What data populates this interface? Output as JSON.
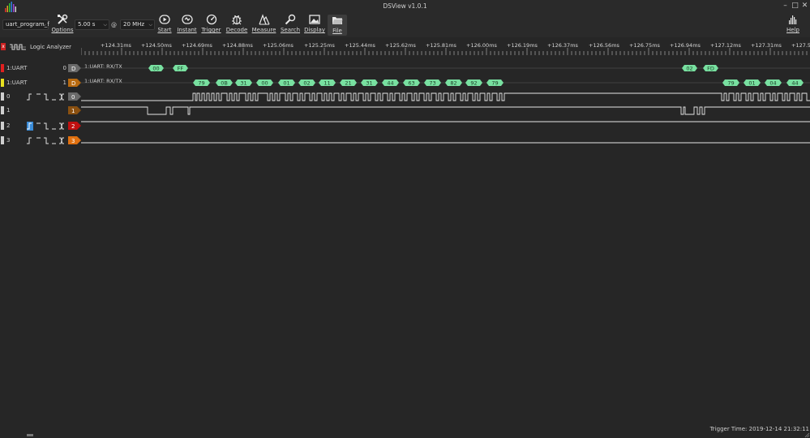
{
  "window": {
    "title": "DSView v1.0.1",
    "controls": {
      "minimize": "–",
      "maximize": "□",
      "close": "✕"
    }
  },
  "toolbar": {
    "device": "uart_program_f",
    "time_value": "5.00 s",
    "at": "@",
    "rate_value": "20 MHz",
    "buttons": {
      "options": "Options",
      "start": "Start",
      "instant": "Instant",
      "trigger": "Trigger",
      "decode": "Decode",
      "measure": "Measure",
      "search": "Search",
      "display": "Display",
      "file": "File",
      "help": "Help"
    }
  },
  "panel": {
    "close": "x",
    "title": "Logic Analyzer"
  },
  "ruler": {
    "labels": [
      "+124.31ms",
      "+124.50ms",
      "+124.69ms",
      "+124.88ms",
      "+125.06ms",
      "+125.25ms",
      "+125.44ms",
      "+125.62ms",
      "+125.81ms",
      "+126.00ms",
      "+126.19ms",
      "+126.37ms",
      "+126.56ms",
      "+126.75ms",
      "+126.94ms",
      "+127.12ms",
      "+127.31ms",
      "+127.50"
    ]
  },
  "channels": {
    "decoders": [
      {
        "label": "1:UART",
        "num": "0",
        "tag": "D",
        "name": "1:UART: RX/TX",
        "color": "#e02020",
        "tag_color": "#6a6a6a"
      },
      {
        "label": "1:UART",
        "num": "1",
        "tag": "D",
        "name": "1:UART: RX/TX",
        "color": "#e8e020",
        "tag_color": "#b86a10"
      }
    ],
    "logic": [
      {
        "label": "0",
        "tag": "0",
        "tag_color": "#6a6a6a"
      },
      {
        "label": "1",
        "tag": "1",
        "tag_color": "#8a5010"
      },
      {
        "label": "2",
        "tag": "2",
        "tag_color": "#c01010"
      },
      {
        "label": "3",
        "tag": "3",
        "tag_color": "#e07010"
      }
    ]
  },
  "decode": {
    "row0": [
      "00",
      "FF",
      "02",
      "FD"
    ],
    "row1": [
      "79",
      "0B",
      "31",
      "00",
      "01",
      "02",
      "11",
      "21",
      "31",
      "44",
      "63",
      "73",
      "82",
      "92",
      "79",
      "79",
      "01",
      "04",
      "44"
    ]
  },
  "status": {
    "trigger_time": "Trigger Time: 2019-12-14 21:32:11"
  },
  "colors": {
    "background": "#262626",
    "accent_green": "#78e0a0",
    "wave": "#e6e6e6",
    "trigger_blue": "#3a8cd8"
  }
}
